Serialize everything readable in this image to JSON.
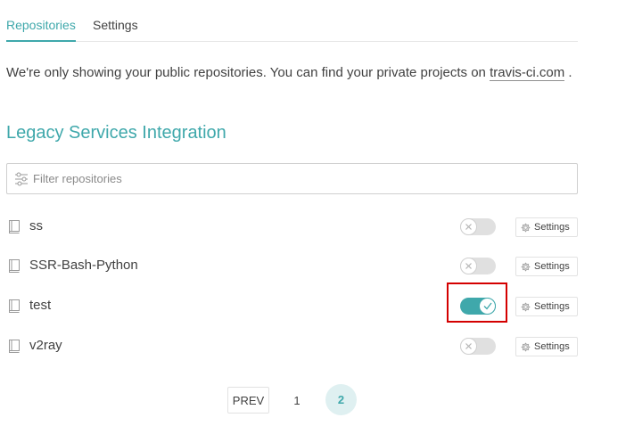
{
  "tabs": [
    {
      "label": "Repositories",
      "active": true
    },
    {
      "label": "Settings",
      "active": false
    }
  ],
  "notice": {
    "text": "We're only showing your public repositories. You can find your private projects on",
    "link": "travis-ci.com",
    "suffix": "."
  },
  "section": {
    "title": "Legacy Services Integration"
  },
  "filter": {
    "placeholder": "Filter repositories",
    "value": "",
    "icon": "filter-sliders-icon"
  },
  "repositories": [
    {
      "name": "ss",
      "active": false,
      "settings_label": "Settings"
    },
    {
      "name": "SSR-Bash-Python",
      "active": false,
      "settings_label": "Settings"
    },
    {
      "name": "test",
      "active": true,
      "settings_label": "Settings"
    },
    {
      "name": "v2ray",
      "active": false,
      "settings_label": "Settings"
    }
  ],
  "pagination": {
    "prev_label": "PREV",
    "pages": [
      "1",
      "2"
    ],
    "current_page": "2"
  },
  "colors": {
    "accent": "#3fa8ab",
    "highlight": "#d40000",
    "toggle_off": "#e0e0e0"
  }
}
